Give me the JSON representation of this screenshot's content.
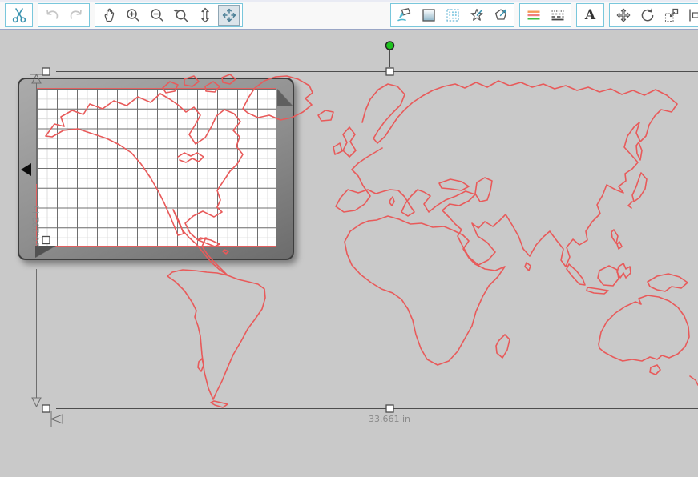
{
  "selection": {
    "width_label": "33.661 in",
    "height_label": "16.292 in"
  },
  "icons": {
    "text_icon_label": "A",
    "toolbar_left": [
      "scissors-cut-icon",
      "undo-icon",
      "redo-icon",
      "pan-hand-icon",
      "zoom-in-icon",
      "zoom-out-icon",
      "zoom-selection-icon",
      "drag-zoom-icon",
      "fit-to-window-icon"
    ],
    "toolbar_right": [
      "fill-color-icon",
      "gradient-fill-icon",
      "pattern-fill-icon",
      "sketch-star-icon",
      "shape-effect-pentagon-icon",
      "line-color-icon",
      "line-style-icon",
      "text-style-icon",
      "transform-move-icon",
      "rotate-icon",
      "scale-icon",
      "align-distribute-icon"
    ]
  },
  "canvas": {
    "mat": {
      "grid_major_columns": 12,
      "grid_major_rows": 8
    },
    "selected_object": "world-map-outline"
  },
  "colors": {
    "canvas_bg": "#c9c9c9",
    "toolbar_bg": "#f8f8f8",
    "group_border": "#79c7dc",
    "map_outline": "#e85a5a",
    "page_border": "#e26060",
    "grid_major": "#6f6f6f",
    "grid_minor": "#dcdcdc",
    "mat_dark": "#3e3e3e",
    "rotate_handle_green": "#1fc21f",
    "selection_line": "#4d4d4d",
    "dimension_text": "#8a8a8a"
  }
}
